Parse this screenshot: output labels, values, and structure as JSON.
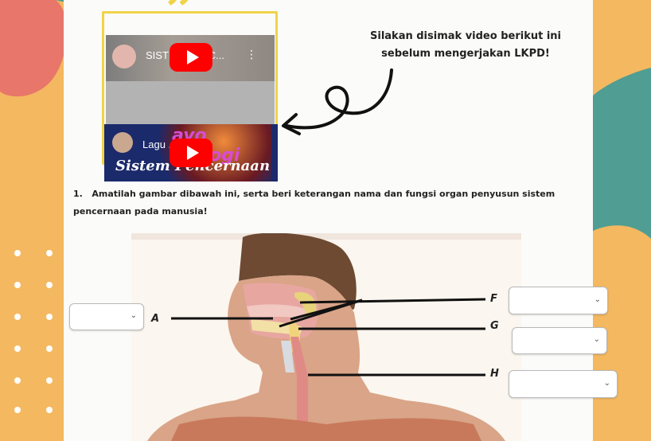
{
  "colors": {
    "orange": "#f4b860",
    "pink": "#e8766a",
    "teal": "#4f9d93",
    "yellow": "#f1d349",
    "paper": "#fbfbf9"
  },
  "videos": [
    {
      "title": "SISTEM PENC...",
      "icon": "youtube-play-icon",
      "menu": "⋮"
    },
    {
      "title": "Lagu ... Si...",
      "icon": "youtube-play-icon",
      "banner_top": "ayo Biologi",
      "banner_bottom": "Sistem Pencernaan"
    }
  ],
  "instruction": {
    "line1": "Silakan disimak video berikut ini",
    "line2": "sebelum mengerjakan LKPD!"
  },
  "question": {
    "number": "1.",
    "text": "Amatilah gambar dibawah ini, serta beri keterangan nama dan fungsi organ penyusun sistem pencernaan pada manusia!"
  },
  "labels": {
    "A": "A",
    "F": "F",
    "G": "G",
    "H": "H"
  },
  "selects": {
    "a": "",
    "f": "",
    "g": "",
    "h": "",
    "chevron": "⌄"
  }
}
